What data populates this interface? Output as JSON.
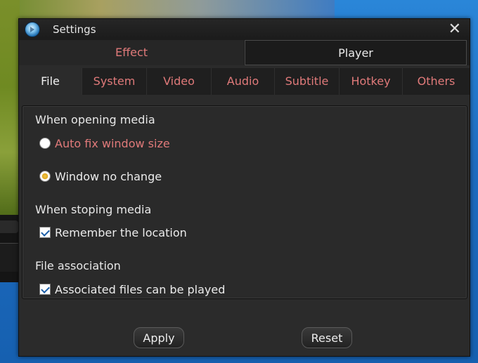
{
  "window": {
    "title": "Settings",
    "close_label": "✕"
  },
  "top_tabs": [
    {
      "label": "Effect",
      "active": false
    },
    {
      "label": "Player",
      "active": true
    }
  ],
  "sub_tabs": [
    {
      "label": "File",
      "active": true
    },
    {
      "label": "System",
      "active": false
    },
    {
      "label": "Video",
      "active": false
    },
    {
      "label": "Audio",
      "active": false
    },
    {
      "label": "Subtitle",
      "active": false
    },
    {
      "label": "Hotkey",
      "active": false
    },
    {
      "label": "Others",
      "active": false
    }
  ],
  "file": {
    "opening_heading": "When opening media",
    "opening_options": [
      {
        "label": "Auto fix window size",
        "selected": false
      },
      {
        "label": "Window no change",
        "selected": true
      }
    ],
    "stopping_heading": "When stoping media",
    "remember_location": {
      "label": "Remember the location",
      "checked": true
    },
    "association_heading": "File association",
    "associate_files": {
      "label": "Associated files can be played",
      "checked": true
    }
  },
  "buttons": {
    "apply": "Apply",
    "reset": "Reset"
  },
  "colors": {
    "accent_text": "#e07a7a",
    "window_bg": "#2b2b2b",
    "radio_selected": "#e0a820",
    "check_mark": "#1d5fa8"
  }
}
